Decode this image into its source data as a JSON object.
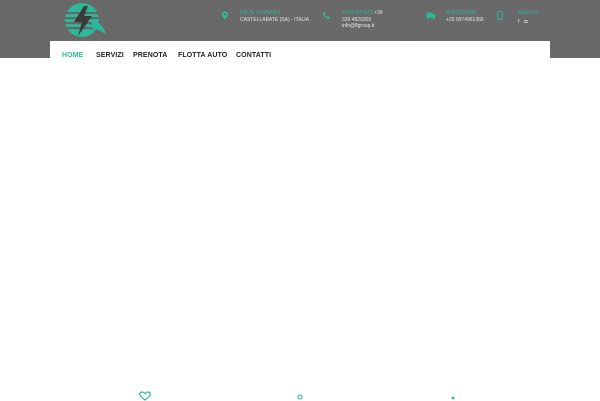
{
  "logo": {
    "name": "company-logo"
  },
  "contact_bar": {
    "address": {
      "label": "VIE N. TOSSANO",
      "value": "CASTELLABATE (SA) - ITALIA",
      "icon": "location-pin-icon"
    },
    "phone": {
      "label": "CONTATTACI",
      "value": "+39 339 4820303",
      "email": "info@lfgroup.it",
      "icon": "phone-icon"
    },
    "shipping": {
      "label": "SPEDIZIONE",
      "value": "+39 0974961366",
      "icon": "truck-icon"
    },
    "social": {
      "label": "SEGUICI",
      "facebook": "f",
      "instagram": "◘",
      "icon": "mobile-icon"
    }
  },
  "nav": {
    "items": [
      {
        "label": "HOME",
        "active": true
      },
      {
        "label": "SERVIZI",
        "active": false
      },
      {
        "label": "PRENOTA",
        "active": false
      },
      {
        "label": "FLOTTA AUTO",
        "active": false
      },
      {
        "label": "CONTATTI",
        "active": false
      }
    ]
  },
  "colors": {
    "accent": "#2cb99b",
    "topbar": "#666666",
    "nav_text": "#222222"
  },
  "bottom_icons": [
    "heart-icon",
    "person-icon",
    "marker-icon"
  ]
}
